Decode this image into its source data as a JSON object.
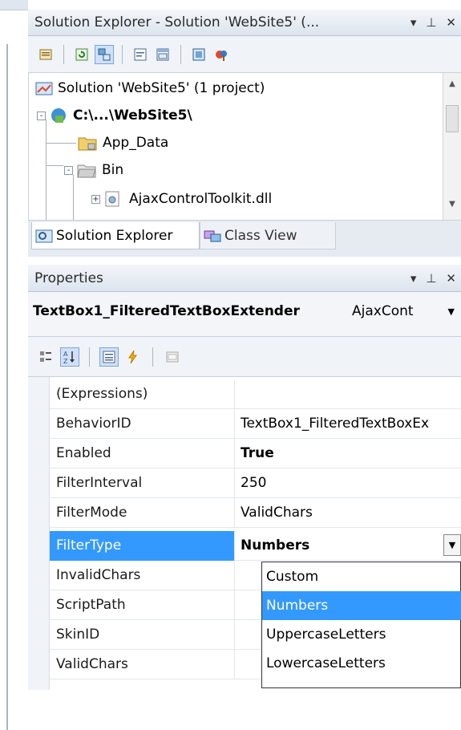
{
  "solution_explorer": {
    "title": "Solution Explorer - Solution 'WebSite5' (...",
    "title_buttons": [
      "▾",
      "⊥",
      "✕"
    ],
    "toolbar_icons": [
      "properties-icon",
      "refresh-icon",
      "nest-related-files-icon",
      "view-code-icon",
      "view-designer-icon",
      "copy-website-icon",
      "asp-config-icon"
    ],
    "tree": [
      {
        "label": "Solution 'WebSite5' (1 project)",
        "icon": "solution-icon",
        "bold": false
      },
      {
        "label": "C:\\...\\WebSite5\\",
        "icon": "website-project-icon",
        "bold": true,
        "expander": "-"
      },
      {
        "label": "App_Data",
        "icon": "folder-icon",
        "bold": false
      },
      {
        "label": "Bin",
        "icon": "folder-open-icon",
        "bold": false,
        "expander": "-"
      },
      {
        "label": "AjaxControlToolkit.dll",
        "icon": "dll-icon",
        "bold": false,
        "expander": "+"
      }
    ],
    "tabs": [
      {
        "label": "Solution Explorer",
        "icon": "solution-explorer-icon",
        "selected": true
      },
      {
        "label": "Class View",
        "icon": "class-view-icon",
        "selected": false
      }
    ]
  },
  "properties": {
    "title": "Properties",
    "title_buttons": [
      "▾",
      "⊥",
      "✕"
    ],
    "object_name": "TextBox1_FilteredTextBoxExtender",
    "object_type": "AjaxCont",
    "toolbar_icons": [
      "categorized-icon",
      "alphabetical-icon",
      "properties-icon",
      "events-icon",
      "property-pages-icon"
    ],
    "rows": [
      {
        "name": "(Expressions)",
        "value": ""
      },
      {
        "name": "BehaviorID",
        "value": "TextBox1_FilteredTextBoxEx"
      },
      {
        "name": "Enabled",
        "value": "True",
        "bold": true
      },
      {
        "name": "FilterInterval",
        "value": "250"
      },
      {
        "name": "FilterMode",
        "value": "ValidChars"
      },
      {
        "name": "FilterType",
        "value": "Numbers",
        "bold": true,
        "selected": true
      },
      {
        "name": "InvalidChars",
        "value": ""
      },
      {
        "name": "ScriptPath",
        "value": ""
      },
      {
        "name": "SkinID",
        "value": ""
      },
      {
        "name": "ValidChars",
        "value": ""
      }
    ],
    "dropdown_options": [
      "Custom",
      "Numbers",
      "UppercaseLetters",
      "LowercaseLetters"
    ],
    "dropdown_selected": "Numbers"
  },
  "colors": {
    "selection": "#3399ff",
    "title_gradient_top": "#f3f6fa",
    "title_gradient_bottom": "#dde4ee"
  }
}
